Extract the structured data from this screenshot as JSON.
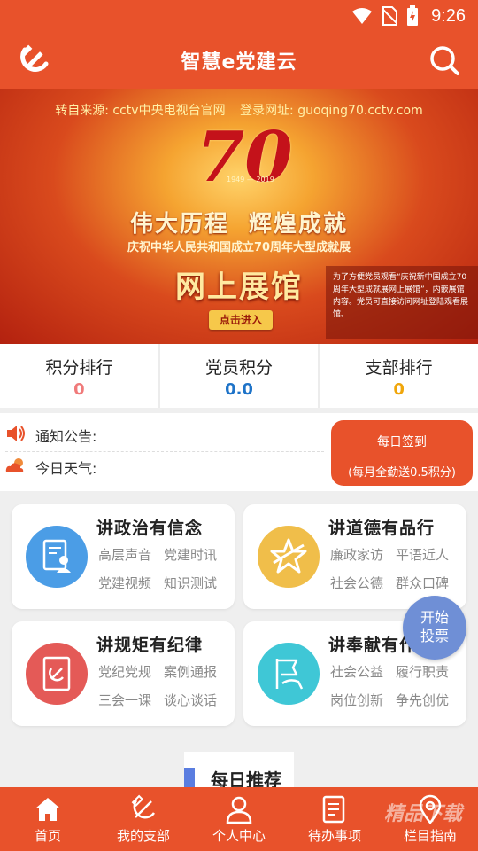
{
  "status_bar": {
    "time": "9:26"
  },
  "header": {
    "title": "智慧e党建云"
  },
  "banner": {
    "source_label": "转自来源: cctv中央电视台官网",
    "url_label": "登录网址: guoqing70.cctv.com",
    "emblem_number": "70",
    "emblem_years": "1949 — 2019",
    "slogan_left": "伟大历程",
    "slogan_right": "辉煌成就",
    "subtitle": "庆祝中华人民共和国成立70周年大型成就展",
    "hall_title": "网上展馆",
    "enter_button": "点击进入",
    "note": "为了方便党员观看“庆祝新中国成立70周年大型成就展网上展馆”，内嵌展馆内容。党员可直接访问网址登陆观看展馆。"
  },
  "stats": [
    {
      "label": "积分排行",
      "value": "0"
    },
    {
      "label": "党员积分",
      "value": "0.0"
    },
    {
      "label": "支部排行",
      "value": "0"
    }
  ],
  "notice": {
    "announcement_label": "通知公告:",
    "weather_label": "今日天气:",
    "checkin_title": "每日签到",
    "checkin_sub": "(每月全勤送0.5积分)"
  },
  "cards": [
    {
      "title": "讲政治有信念",
      "tags": [
        "高层声音",
        "党建时讯",
        "党建视频",
        "知识测试"
      ],
      "color": "#4b9de6"
    },
    {
      "title": "讲道德有品行",
      "tags": [
        "廉政家访",
        "平语近人",
        "社会公德",
        "群众口碑"
      ],
      "color": "#f0be4a"
    },
    {
      "title": "讲规矩有纪律",
      "tags": [
        "党纪党规",
        "案例通报",
        "三会一课",
        "谈心谈话"
      ],
      "color": "#e45a57"
    },
    {
      "title": "讲奉献有作为",
      "tags": [
        "社会公益",
        "履行职责",
        "岗位创新",
        "争先创优"
      ],
      "color": "#3fc7d6"
    }
  ],
  "vote_button": {
    "line1": "开始",
    "line2": "投票"
  },
  "daily_recommend": "每日推荐",
  "bottom_nav": [
    {
      "label": "首页",
      "icon": "home-icon"
    },
    {
      "label": "我的支部",
      "icon": "hammer-sickle-icon"
    },
    {
      "label": "个人中心",
      "icon": "user-icon"
    },
    {
      "label": "待办事项",
      "icon": "todo-icon"
    },
    {
      "label": "栏目指南",
      "icon": "location-icon"
    }
  ],
  "watermark": "精品下载",
  "colors": {
    "brand": "#e8522b"
  }
}
